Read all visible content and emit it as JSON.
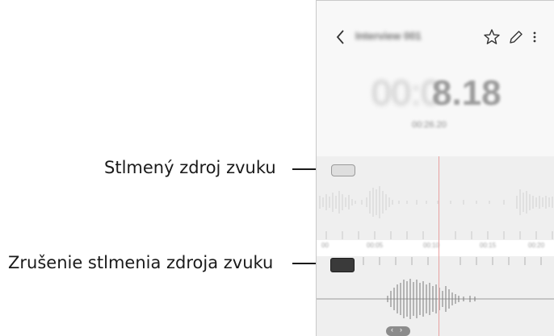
{
  "callouts": {
    "muted_label": "Stlmený zdroj zvuku",
    "unmuted_label": "Zrušenie stlmenia zdroja zvuku"
  },
  "app": {
    "title": "Interview 001",
    "timer_faded": "00:0",
    "timer_main": "8.18",
    "sub_time": "00:26.20"
  },
  "ruler": {
    "labels": [
      "00",
      "00:05",
      "00:10",
      "00:15",
      "00:20"
    ]
  },
  "icons": {
    "back": "chevron-left-icon",
    "favorite": "star-outline-icon",
    "edit": "pencil-icon",
    "more": "more-vertical-icon"
  },
  "colors": {
    "playhead": "#e8a0a0",
    "muted_tag": "#dedede",
    "unmuted_tag": "#3a3a3a"
  }
}
